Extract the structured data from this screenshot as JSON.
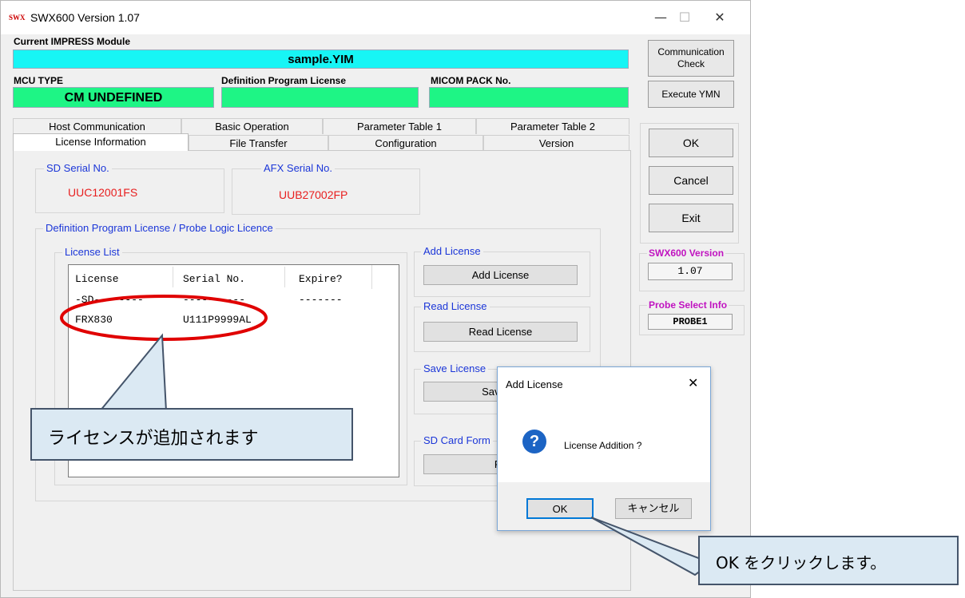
{
  "window": {
    "title": "SWX600   Version  1.07",
    "app_icon_text": "SWX",
    "controls": {
      "minimize": "—",
      "maximize": "☐",
      "close": "✕"
    }
  },
  "header": {
    "current_module_label": "Current IMPRESS Module",
    "module_name": "sample.YIM",
    "mcu_type_label": "MCU TYPE",
    "mcu_type_value": "CM UNDEFINED",
    "def_license_label": "Definition Program License",
    "def_license_value": "",
    "micom_pack_label": "MICOM PACK No.",
    "micom_pack_value": ""
  },
  "side_buttons": {
    "communication_check_line1": "Communication",
    "communication_check_line2": "Check",
    "execute_ymn": "Execute YMN",
    "ok": "OK",
    "cancel": "Cancel",
    "exit": "Exit"
  },
  "side_info": {
    "version_title": "SWX600 Version",
    "version_value": "1.07",
    "probe_title": "Probe Select Info",
    "probe_value": "PROBE1"
  },
  "tabs": {
    "row1": [
      "Host Communication",
      "Basic Operation",
      "Parameter Table 1",
      "Parameter Table 2"
    ],
    "row2": [
      "License Information",
      "File Transfer",
      "Configuration",
      "Version"
    ],
    "active": "License Information"
  },
  "license_info": {
    "sd_serial_title": "SD Serial No.",
    "sd_serial_value": "UUC12001FS",
    "afx_serial_title": "AFX Serial No.",
    "afx_serial_value": "UUB27002FP",
    "def_group_title": "Definition Program License / Probe Logic Licence",
    "license_list_title": "License List",
    "columns": [
      "License",
      "Serial No.",
      "Expire?"
    ],
    "rows": [
      [
        "-SD--------",
        "----------",
        "-------"
      ],
      [
        "FRX830",
        "U111P9999AL",
        ""
      ]
    ],
    "add_license_title": "Add License",
    "add_license_button": "Add License",
    "read_license_title": "Read License",
    "read_license_button": "Read License",
    "save_license_title": "Save License",
    "save_license_button": "Save To",
    "sd_format_title": "SD Card Form",
    "sd_format_button": "Fo"
  },
  "dialog": {
    "title": "Add License",
    "close": "✕",
    "icon": "?",
    "message": "License Addition ?",
    "ok": "OK",
    "cancel": "キャンセル"
  },
  "callouts": {
    "license_added": "ライセンスが追加されます",
    "click_ok": "OK をクリックします。"
  },
  "colors": {
    "module_bar": "#17f5f5",
    "green_fields": "#1ef585",
    "group_title": "#1b36d8",
    "serial_red": "#e81e1e",
    "side_title": "#c012c0",
    "annotation_red": "#e00000",
    "callout_bg": "#dbe9f3"
  }
}
